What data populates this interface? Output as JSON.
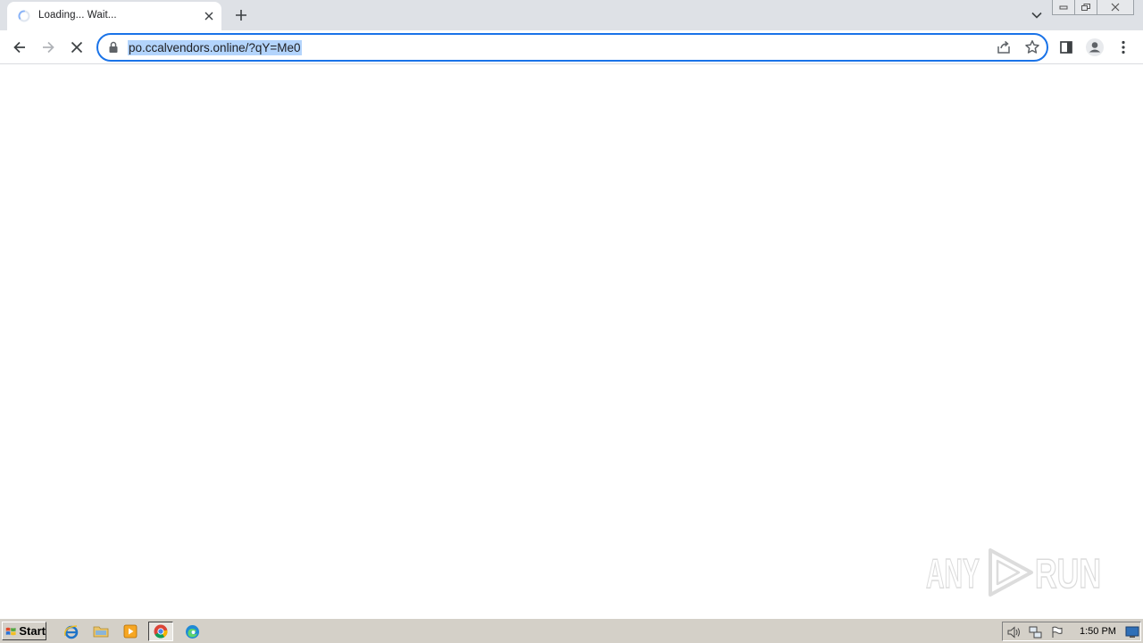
{
  "browser": {
    "tab": {
      "title": "Loading... Wait...",
      "favicon": "loading-spinner-icon",
      "close_icon": "close-icon"
    },
    "new_tab_icon": "plus-icon",
    "tab_search_icon": "chevron-down-icon",
    "window_controls": [
      "minimize-icon",
      "restore-icon",
      "close-icon"
    ]
  },
  "toolbar": {
    "back_icon": "arrow-left-icon",
    "forward_icon": "arrow-right-icon",
    "stop_icon": "stop-x-icon",
    "address": {
      "lock_icon": "lock-icon",
      "url": "po.ccalvendors.online/?qY=Me0",
      "share_icon": "share-icon",
      "bookmark_icon": "star-icon"
    },
    "side_panel_icon": "side-panel-icon",
    "profile_icon": "profile-icon",
    "menu_icon": "kebab-menu-icon",
    "accent_color": "#1a73e8"
  },
  "content": {
    "watermark": "ANY RUN"
  },
  "taskbar": {
    "start_label": "Start",
    "quick_launch": [
      "internet-explorer-icon",
      "folder-icon",
      "media-player-icon",
      "chrome-icon",
      "edge-icon"
    ],
    "tray_icons": [
      "volume-icon",
      "network-icon",
      "flag-icon"
    ],
    "clock": "1:50 PM",
    "show_desktop_icon": "desktop-icon"
  }
}
